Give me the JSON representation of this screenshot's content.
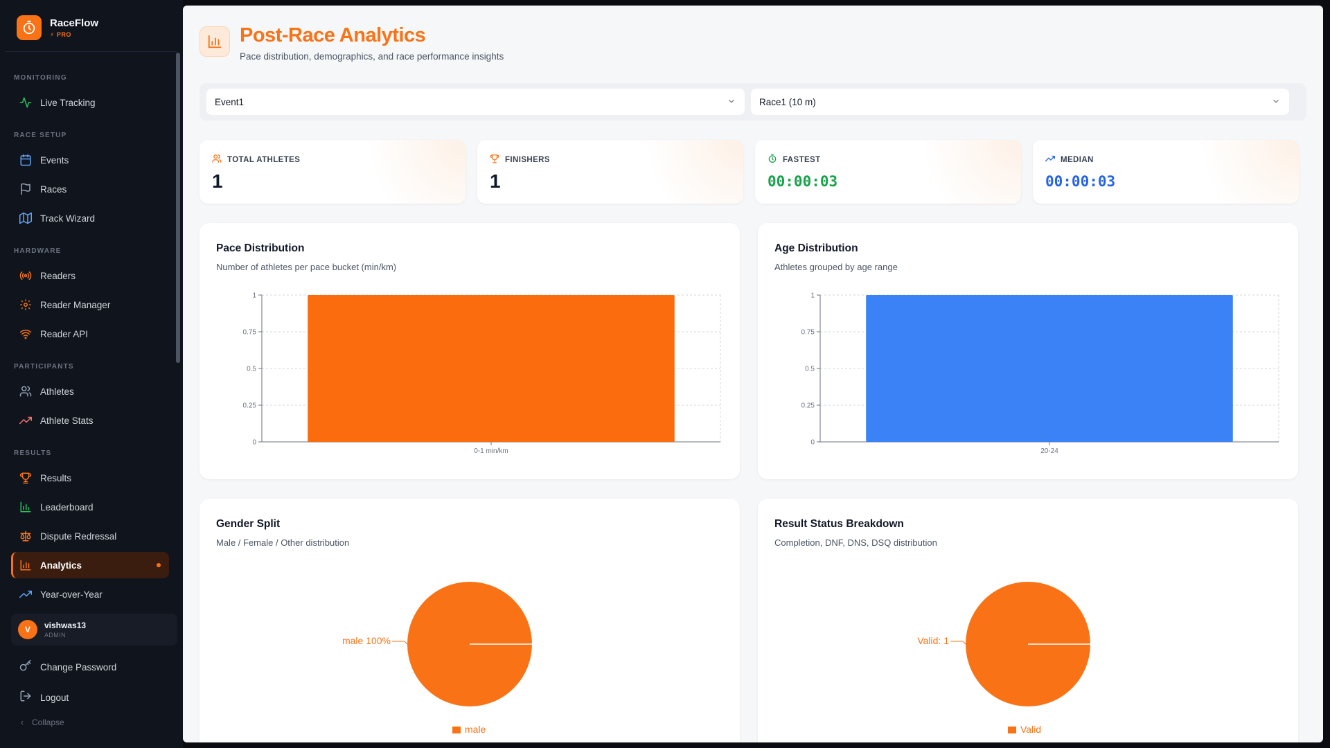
{
  "app": {
    "name": "RaceFlow",
    "tier": "PRO"
  },
  "nav": {
    "sections": [
      {
        "label": "MONITORING",
        "items": [
          {
            "label": "Live Tracking",
            "icon": "activity-icon"
          }
        ]
      },
      {
        "label": "RACE SETUP",
        "items": [
          {
            "label": "Events",
            "icon": "calendar-icon"
          },
          {
            "label": "Races",
            "icon": "flag-icon"
          },
          {
            "label": "Track Wizard",
            "icon": "map-icon"
          }
        ]
      },
      {
        "label": "HARDWARE",
        "items": [
          {
            "label": "Readers",
            "icon": "radio-icon"
          },
          {
            "label": "Reader Manager",
            "icon": "gear-icon"
          },
          {
            "label": "Reader API",
            "icon": "wifi-icon"
          }
        ]
      },
      {
        "label": "PARTICIPANTS",
        "items": [
          {
            "label": "Athletes",
            "icon": "users-icon"
          },
          {
            "label": "Athlete Stats",
            "icon": "trending-up-icon"
          }
        ]
      },
      {
        "label": "RESULTS",
        "items": [
          {
            "label": "Results",
            "icon": "trophy-icon"
          },
          {
            "label": "Leaderboard",
            "icon": "bar-chart-icon"
          },
          {
            "label": "Dispute Redressal",
            "icon": "scale-icon"
          },
          {
            "label": "Analytics",
            "icon": "analytics-icon",
            "active": true
          },
          {
            "label": "Year-over-Year",
            "icon": "trending-up-icon"
          }
        ]
      }
    ]
  },
  "user": {
    "initial": "V",
    "name": "vishwas13",
    "role": "ADMIN"
  },
  "bottom": {
    "change_password": "Change Password",
    "logout": "Logout",
    "collapse": "Collapse"
  },
  "page": {
    "title": "Post-Race Analytics",
    "subtitle": "Pace distribution, demographics, and race performance insights"
  },
  "filters": {
    "event": "Event1",
    "race": "Race1 (10 m)"
  },
  "stats": [
    {
      "label": "TOTAL ATHLETES",
      "value": "1",
      "icon": "users-icon"
    },
    {
      "label": "FINISHERS",
      "value": "1",
      "icon": "trophy-icon"
    },
    {
      "label": "FASTEST",
      "value": "00:00:03",
      "icon": "stopwatch-icon",
      "color": "#16a34a"
    },
    {
      "label": "MEDIAN",
      "value": "00:00:03",
      "icon": "trending-up-icon",
      "color": "#2563eb"
    }
  ],
  "colors": {
    "accent": "#f97316",
    "bar_orange": "#fb6c0e",
    "bar_blue": "#3b82f6",
    "pie_orange": "#f97316"
  },
  "cards": {
    "pace": {
      "title": "Pace Distribution",
      "subtitle": "Number of athletes per pace bucket (min/km)"
    },
    "age": {
      "title": "Age Distribution",
      "subtitle": "Athletes grouped by age range"
    },
    "gender": {
      "title": "Gender Split",
      "subtitle": "Male / Female / Other distribution"
    },
    "status": {
      "title": "Result Status Breakdown",
      "subtitle": "Completion, DNF, DNS, DSQ distribution"
    }
  },
  "chart_data": [
    {
      "type": "bar",
      "title": "Pace Distribution",
      "categories": [
        "0-1 min/km"
      ],
      "values": [
        1
      ],
      "ylim": [
        0,
        1
      ],
      "yticks": [
        "0",
        "0.25",
        "0.5",
        "0.75",
        "1"
      ],
      "grid": true,
      "color": "#fb6c0e"
    },
    {
      "type": "bar",
      "title": "Age Distribution",
      "categories": [
        "20-24"
      ],
      "values": [
        1
      ],
      "ylim": [
        0,
        1
      ],
      "yticks": [
        "0",
        "0.25",
        "0.5",
        "0.75",
        "1"
      ],
      "grid": true,
      "color": "#3b82f6"
    },
    {
      "type": "pie",
      "title": "Gender Split",
      "labels": [
        "male"
      ],
      "values": [
        100
      ],
      "slice_labels": [
        "male 100%"
      ],
      "legend": [
        "male"
      ],
      "legend_position": "bottom"
    },
    {
      "type": "pie",
      "title": "Result Status Breakdown",
      "labels": [
        "Valid"
      ],
      "values": [
        1
      ],
      "slice_labels": [
        "Valid: 1"
      ],
      "legend": [
        "Valid"
      ],
      "legend_position": "bottom"
    }
  ]
}
